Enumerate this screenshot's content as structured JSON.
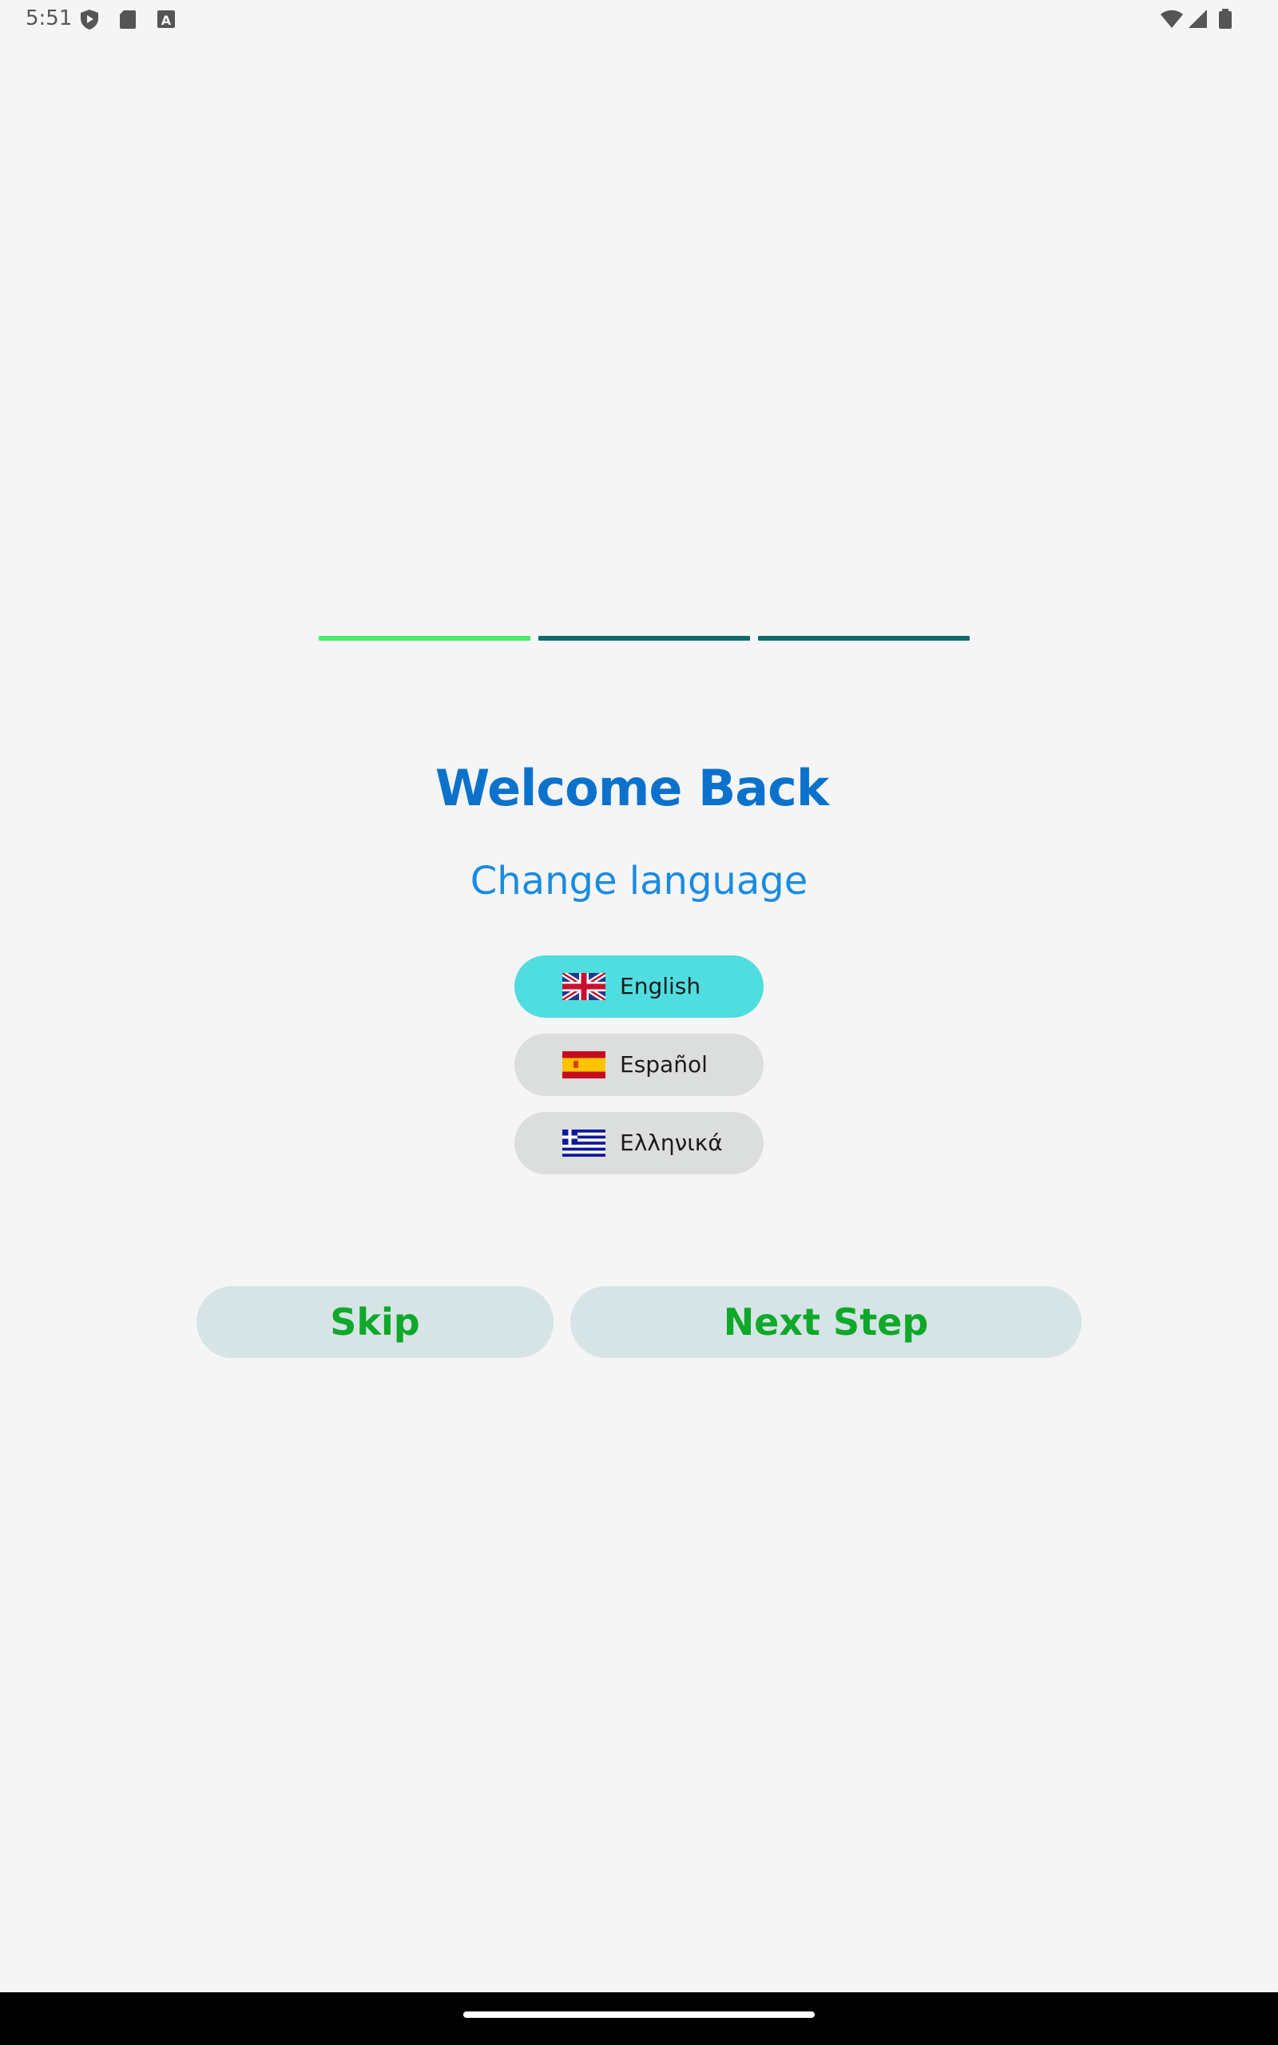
{
  "status_bar": {
    "time": "5:51",
    "left_icons": [
      "shield-play-icon",
      "sd-card-icon",
      "text-a-icon"
    ],
    "right_icons": [
      "wifi-icon",
      "signal-icon",
      "battery-icon"
    ]
  },
  "progress": {
    "steps": 3,
    "current_step": 1,
    "colors": {
      "active": "#4cea6a",
      "inactive": "#11696b"
    }
  },
  "header": {
    "title": "Welcome Back",
    "subtitle": "Change language",
    "title_color": "#0b72cc",
    "subtitle_color": "#1a8be0"
  },
  "languages": {
    "items": [
      {
        "label": "English",
        "flag": "uk-flag-icon",
        "selected": true
      },
      {
        "label": "Español",
        "flag": "spain-flag-icon",
        "selected": false
      },
      {
        "label": "Ελληνικά",
        "flag": "greece-flag-icon",
        "selected": false
      }
    ],
    "selected_color": "#4fdde0",
    "unselected_color": "#dcdddd"
  },
  "actions": {
    "skip_label": "Skip",
    "next_label": "Next Step",
    "label_color": "#10a82a",
    "button_color": "#d6e4e6"
  }
}
